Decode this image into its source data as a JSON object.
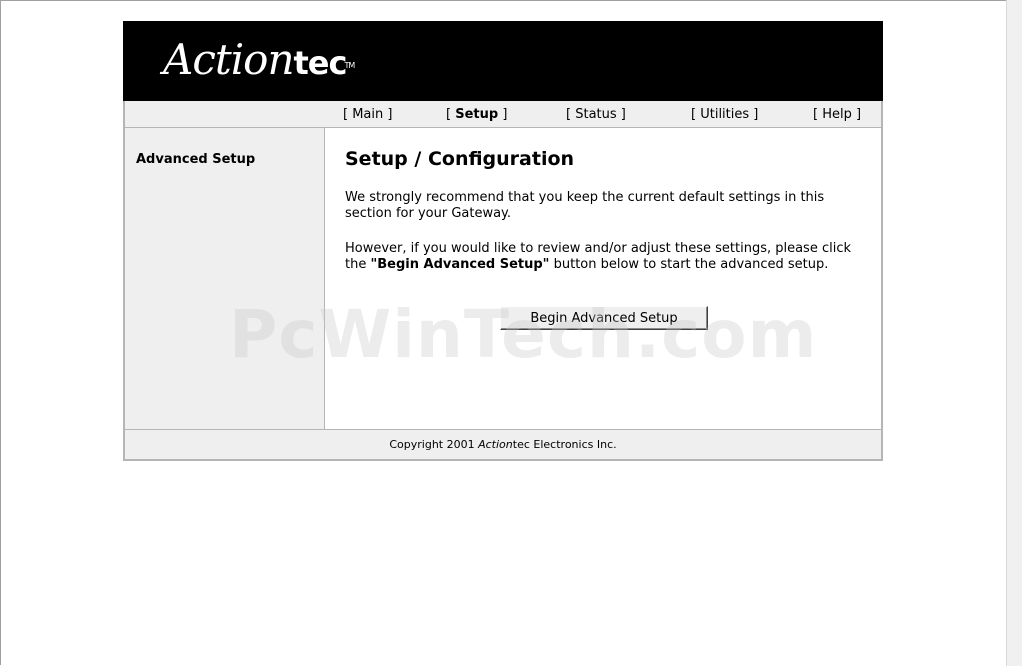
{
  "header": {
    "logo_prefix": "Action",
    "logo_suffix": "tec",
    "logo_tm": "TM"
  },
  "nav": {
    "items": [
      {
        "label": "Main",
        "active": false
      },
      {
        "label": "Setup",
        "active": true
      },
      {
        "label": "Status",
        "active": false
      },
      {
        "label": "Utilities",
        "active": false
      },
      {
        "label": "Help",
        "active": false
      }
    ]
  },
  "sidebar": {
    "title": "Advanced Setup"
  },
  "main": {
    "title": "Setup / Configuration",
    "paragraph1": "We strongly recommend that you keep the current default settings in this section for your Gateway.",
    "paragraph2_before": "However, if you would like to review and/or adjust these settings, please click the ",
    "paragraph2_bold": "\"Begin Advanced Setup\"",
    "paragraph2_after": " button below to start the advanced setup.",
    "button_label": "Begin Advanced Setup"
  },
  "footer": {
    "copyright_before": "Copyright 2001 ",
    "copyright_brand_italic": "Action",
    "copyright_brand_rest": "tec",
    "copyright_after": " Electronics Inc."
  },
  "watermark": "PcWinTech.com"
}
